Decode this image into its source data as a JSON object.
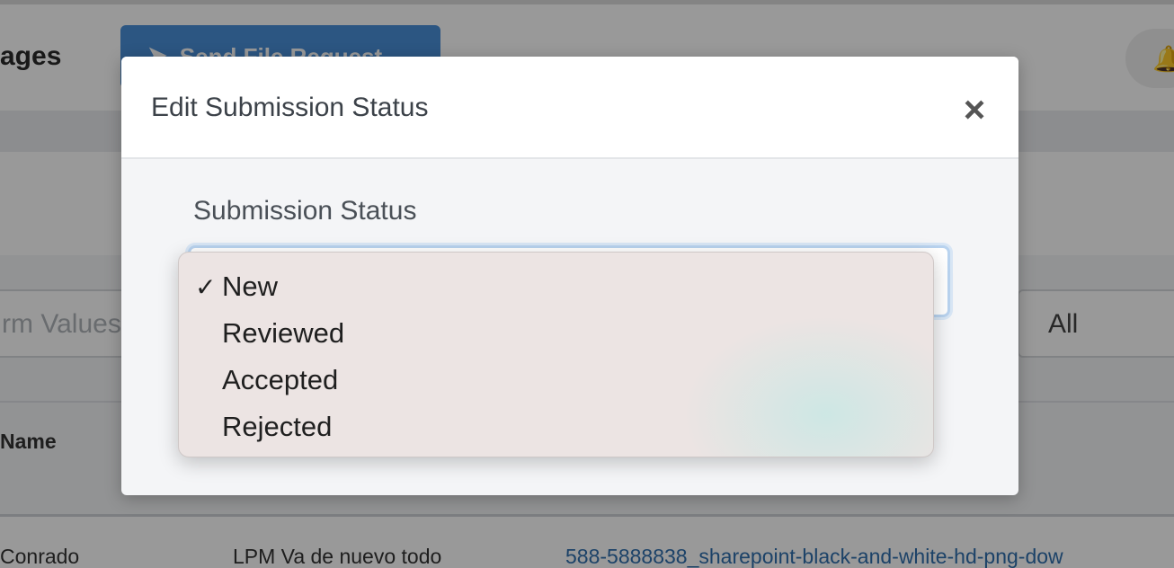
{
  "background": {
    "page_title": "ages",
    "send_button_label": "Send File Request",
    "search_placeholder": "rm Values",
    "filter_value": "All",
    "column_name_header": "Name",
    "row": {
      "name": "Conrado",
      "form": "LPM Va de nuevo todo",
      "file": "588-5888838_sharepoint-black-and-white-hd-png-dow"
    }
  },
  "modal": {
    "title": "Edit Submission Status",
    "close_glyph": "×",
    "field_label": "Submission Status",
    "select": {
      "selected": "New",
      "options": [
        "New",
        "Reviewed",
        "Accepted",
        "Rejected"
      ]
    }
  },
  "icons": {
    "send": "paper-plane-icon",
    "bell": "bell-icon",
    "check": "checkmark-icon",
    "chevron": "chevron-down-icon"
  },
  "colors": {
    "accent": "#4a90d9",
    "link": "#2f6fad",
    "select_focus": "#b9d3ef"
  }
}
